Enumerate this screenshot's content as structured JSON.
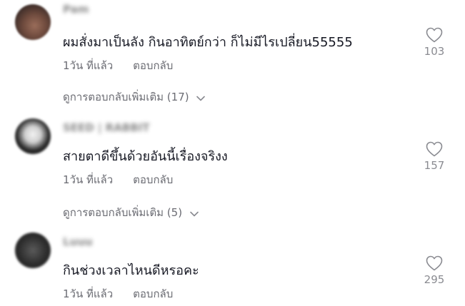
{
  "comments": [
    {
      "username": "Pam",
      "text": "ผมสั่งมาเป็นลัง กินอาทิตย์กว่า ก็ไม่มีไรเปลี่ยน55555",
      "time": "1วัน ที่แล้ว",
      "reply_label": "ตอบกลับ",
      "likes": "103",
      "view_more": "ดูการตอบกลับเพิ่มเติม (17)"
    },
    {
      "username": "SEED | RABBIT",
      "text": "สายตาดีขึ้นด้วยอันนี้เรื่องจริงง",
      "time": "1วัน ที่แล้ว",
      "reply_label": "ตอบกลับ",
      "likes": "157",
      "view_more": "ดูการตอบกลับเพิ่มเติม (5)"
    },
    {
      "username": "Luuu",
      "text": "กินช่วงเวลาไหนดีหรอคะ",
      "time": "1วัน ที่แล้ว",
      "reply_label": "ตอบกลับ",
      "likes": "295"
    }
  ],
  "icons": {
    "like": "heart-outline-icon",
    "expand": "chevron-down-icon"
  }
}
